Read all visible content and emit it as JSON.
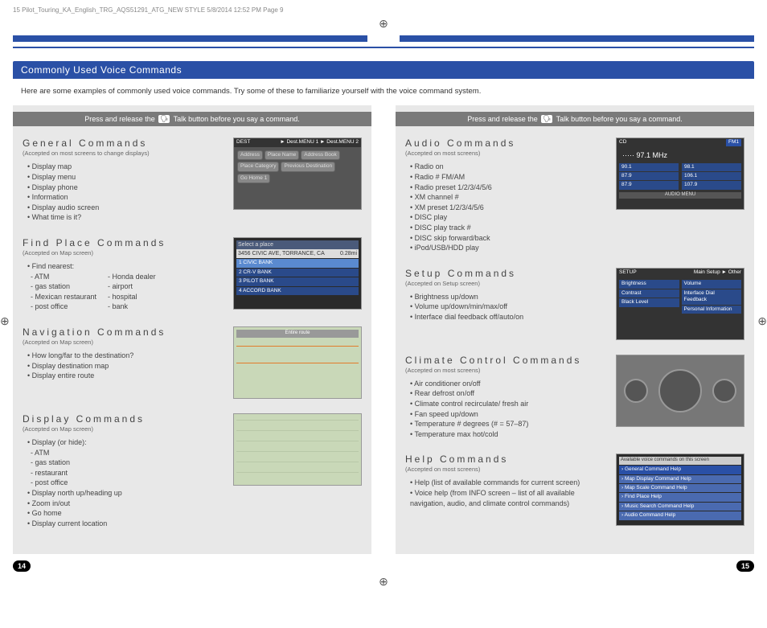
{
  "slugline": "15 Pilot_Touring_KA_English_TRG_AQS51291_ATG_NEW STYLE  5/8/2014  12:52 PM  Page 9",
  "title": "Commonly Used Voice Commands",
  "intro": "Here are some examples of commonly used voice commands. Try some of these to familiarize yourself with the voice command system.",
  "press_prefix": "Press and release the",
  "press_suffix": "Talk button before you say a command.",
  "pagenum_left": "14",
  "pagenum_right": "15",
  "left": {
    "general": {
      "heading": "General Commands",
      "accepted": "(Accepted on most screens to change displays)",
      "items": [
        "Display map",
        "Display menu",
        "Display phone",
        "Information",
        "Display audio screen",
        "What time is it?"
      ],
      "thumb": {
        "hdr_l": "DEST",
        "hdr_r": "► Dest.MENU 1 ► Dest.MENU 2",
        "btns": [
          "Address",
          "Place Name",
          "Address Book",
          "Place Category",
          "Previous Destination",
          "Go Home 1"
        ]
      }
    },
    "find": {
      "heading": "Find Place Commands",
      "accepted": "(Accepted on Map screen)",
      "lead": "Find nearest:",
      "col1": [
        "- ATM",
        "- gas station",
        "- Mexican restaurant",
        "- post office"
      ],
      "col2": [
        "- Honda dealer",
        "- airport",
        "- hospital",
        "- bank"
      ],
      "thumb": {
        "title": "Select a place",
        "addr": "3456 CIVIC AVE, TORRANCE, CA",
        "dist": "0.28mi",
        "rows": [
          "1  CIVIC BANK",
          "2  CR-V BANK",
          "3  PILOT BANK",
          "4  ACCORD BANK"
        ]
      }
    },
    "nav": {
      "heading": "Navigation Commands",
      "accepted": "(Accepted on Map screen)",
      "items": [
        "How long/far to the destination?",
        "Display destination map",
        "Display entire route"
      ]
    },
    "display": {
      "heading": "Display Commands",
      "accepted": "(Accepted on Map screen)",
      "lead": "Display (or hide):",
      "sub": [
        "- ATM",
        "- gas station",
        "- restaurant",
        "- post office"
      ],
      "rest": [
        "Display north up/heading up",
        "Zoom in/out",
        "Go home",
        "Display current location"
      ]
    }
  },
  "right": {
    "audio": {
      "heading": "Audio Commands",
      "accepted": "(Accepted on most screens)",
      "items": [
        "Radio on",
        "Radio # FM/AM",
        "Radio preset 1/2/3/4/5/6",
        "XM channel #",
        "XM preset 1/2/3/4/5/6",
        "DISC play",
        "DISC play track #",
        "DISC skip forward/back",
        "iPod/USB/HDD play"
      ],
      "thumb": {
        "hdr_l": "CD",
        "hdr_r": "FM1",
        "freq": "97.1 MHz",
        "presets_l": [
          "90.1",
          "87.9",
          "87.9"
        ],
        "presets_r": [
          "98.1",
          "106.1",
          "107.9"
        ],
        "foot": "AUDIO MENU"
      }
    },
    "setup": {
      "heading": "Setup Commands",
      "accepted": "(Accepted on Setup screen)",
      "items": [
        "Brightness up/down",
        "Volume up/down/min/max/off",
        "Interface dial feedback off/auto/on"
      ],
      "thumb": {
        "hdr_l": "SETUP",
        "hdr_r": "Main Setup ► Other",
        "rows_l": [
          "Brightness",
          "Contrast",
          "Black Level"
        ],
        "rows_r": [
          "Volume",
          "Interface Dial Feedback",
          "Personal Information"
        ]
      }
    },
    "climate": {
      "heading": "Climate Control Commands",
      "accepted": "(Accepted on most screens)",
      "items": [
        "Air conditioner on/off",
        "Rear defrost on/off",
        "Climate control recirculate/ fresh air",
        "Fan speed up/down",
        "Temperature # degrees (# = 57–87)",
        "Temperature max hot/cold"
      ]
    },
    "help": {
      "heading": "Help Commands",
      "accepted": "(Accepted on most screens)",
      "items": [
        "Help (list of available commands for current screen)",
        "Voice help (from INFO screen – list of all available navigation, audio, and climate control commands)"
      ],
      "thumb": {
        "title": "Available voice commands on this screen",
        "rows": [
          "General Command Help",
          "Map Display Command Help",
          "Map Scale Command Help",
          "Find Place Help",
          "Music Search Command Help",
          "Audio Command Help"
        ]
      }
    }
  }
}
